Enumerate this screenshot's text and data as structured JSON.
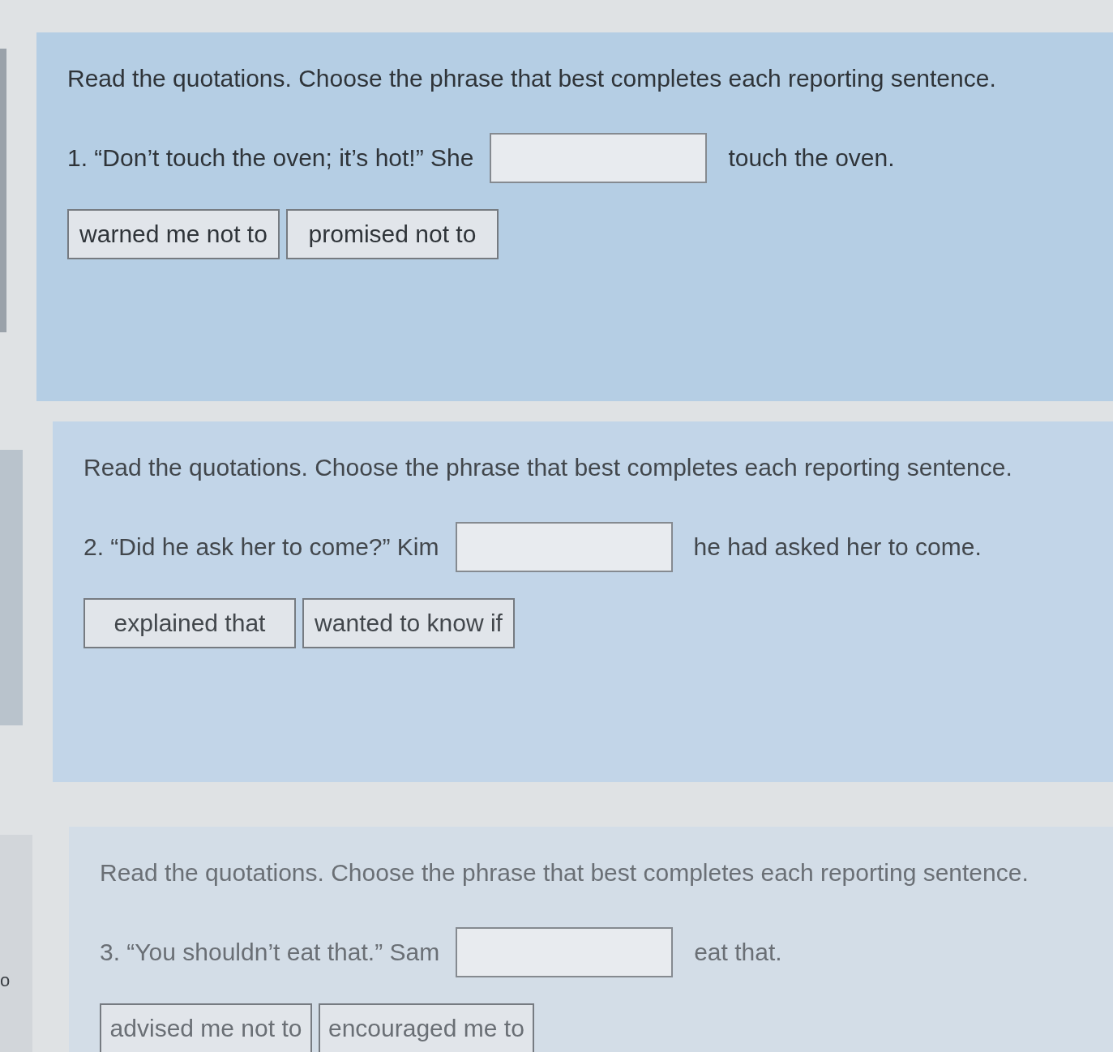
{
  "side_panel": {
    "text": "o"
  },
  "questions": [
    {
      "instruction": "Read the quotations. Choose the phrase that best completes each reporting sentence.",
      "prompt": "1. “Don’t touch the oven; it’s hot!” She",
      "ending": "touch the oven.",
      "options": [
        {
          "label": "warned me not to",
          "selected": false
        },
        {
          "label": "promised not to",
          "selected": false
        }
      ]
    },
    {
      "instruction": "Read the quotations. Choose the phrase that best completes each reporting sentence.",
      "prompt": "2. “Did he ask her to come?” Kim",
      "ending": "he had asked her to come.",
      "options": [
        {
          "label": "explained that",
          "selected": false
        },
        {
          "label": "wanted to know if",
          "selected": false
        }
      ]
    },
    {
      "instruction": "Read the quotations. Choose the phrase that best completes each reporting sentence.",
      "prompt": "3. “You shouldn’t eat that.” Sam",
      "ending": "eat that.",
      "options": [
        {
          "label": "advised me not to",
          "selected": false
        },
        {
          "label": "encouraged me to",
          "selected": false
        }
      ]
    }
  ]
}
